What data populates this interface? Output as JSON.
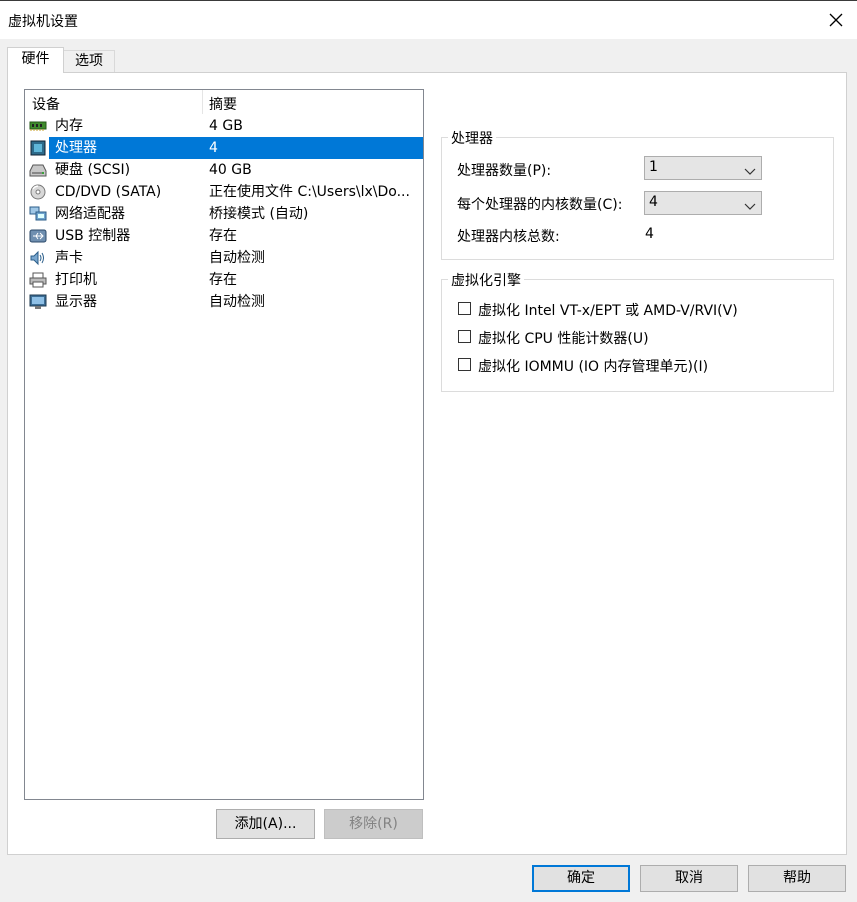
{
  "window": {
    "title": "虚拟机设置"
  },
  "tabs": [
    {
      "label": "硬件",
      "active": true
    },
    {
      "label": "选项",
      "active": false
    }
  ],
  "device_list": {
    "columns": [
      "设备",
      "摘要"
    ],
    "rows": [
      {
        "icon": "memory-icon",
        "name": "内存",
        "summary": "4 GB",
        "selected": false
      },
      {
        "icon": "processor-icon",
        "name": "处理器",
        "summary": "4",
        "selected": true
      },
      {
        "icon": "hard-disk-icon",
        "name": "硬盘 (SCSI)",
        "summary": "40 GB",
        "selected": false
      },
      {
        "icon": "cd-dvd-icon",
        "name": "CD/DVD (SATA)",
        "summary": "正在使用文件 C:\\Users\\lx\\Do...",
        "selected": false
      },
      {
        "icon": "network-adapter-icon",
        "name": "网络适配器",
        "summary": "桥接模式 (自动)",
        "selected": false
      },
      {
        "icon": "usb-icon",
        "name": "USB 控制器",
        "summary": "存在",
        "selected": false
      },
      {
        "icon": "sound-card-icon",
        "name": "声卡",
        "summary": "自动检测",
        "selected": false
      },
      {
        "icon": "printer-icon",
        "name": "打印机",
        "summary": "存在",
        "selected": false
      },
      {
        "icon": "display-icon",
        "name": "显示器",
        "summary": "自动检测",
        "selected": false
      }
    ],
    "add_button": "添加(A)...",
    "remove_button": "移除(R)"
  },
  "processor_group": {
    "title": "处理器",
    "count_label": "处理器数量(P):",
    "count_value": "1",
    "cores_label": "每个处理器的内核数量(C):",
    "cores_value": "4",
    "total_label": "处理器内核总数:",
    "total_value": "4"
  },
  "virtualization_group": {
    "title": "虚拟化引擎",
    "options": [
      {
        "label": "虚拟化 Intel VT-x/EPT 或 AMD-V/RVI(V)",
        "checked": false
      },
      {
        "label": "虚拟化 CPU 性能计数器(U)",
        "checked": false
      },
      {
        "label": "虚拟化 IOMMU (IO 内存管理单元)(I)",
        "checked": false
      }
    ]
  },
  "footer": {
    "ok": "确定",
    "cancel": "取消",
    "help": "帮助"
  },
  "colors": {
    "selection": "#0078d7",
    "dialog_bg": "#f0f0f0",
    "default_button_border": "#0078d7"
  }
}
